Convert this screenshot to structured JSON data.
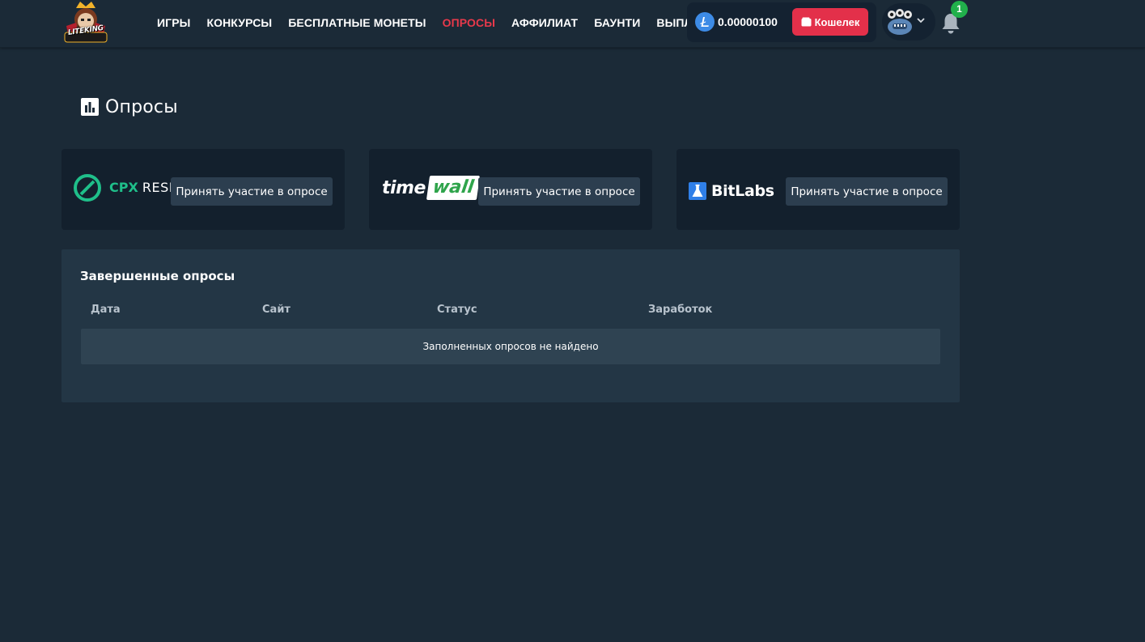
{
  "header": {
    "logo_text": "LITEKING",
    "nav": [
      {
        "label": "ИГРЫ",
        "active": false
      },
      {
        "label": "КОНКУРСЫ",
        "active": false
      },
      {
        "label": "БЕСПЛАТНЫЕ МОНЕТЫ",
        "active": false
      },
      {
        "label": "ОПРОСЫ",
        "active": true
      },
      {
        "label": "АФФИЛИАТ",
        "active": false
      },
      {
        "label": "БАУНТИ",
        "active": false
      },
      {
        "label": "ВЫПЛАТЫ",
        "active": false
      }
    ],
    "balance": "0.00000100",
    "coin_icon": "litecoin-icon",
    "wallet_label": "Кошелек",
    "notification_count": "1",
    "colors": {
      "accent": "#e8394b",
      "wallet_button": "#e3304a",
      "badge": "#21b04b",
      "background": "#1b2a37"
    }
  },
  "page": {
    "title": "Опросы",
    "title_icon": "bar-chart-icon"
  },
  "providers": [
    {
      "name": "CPX RESEARCH",
      "logo_part1": "CPX",
      "logo_part2": "RESEARCH",
      "button_label": "Принять участие в опросе"
    },
    {
      "name": "timewall",
      "logo_part1": "time",
      "logo_part2": "wall",
      "button_label": "Принять участие в опросе"
    },
    {
      "name": "BitLabs",
      "logo_part1": "BitLabs",
      "button_label": "Принять участие в опросе"
    }
  ],
  "completed": {
    "title": "Завершенные опросы",
    "columns": [
      "Дата",
      "Сайт",
      "Статус",
      "Заработок"
    ],
    "empty_message": "Заполненных опросов не найдено"
  }
}
